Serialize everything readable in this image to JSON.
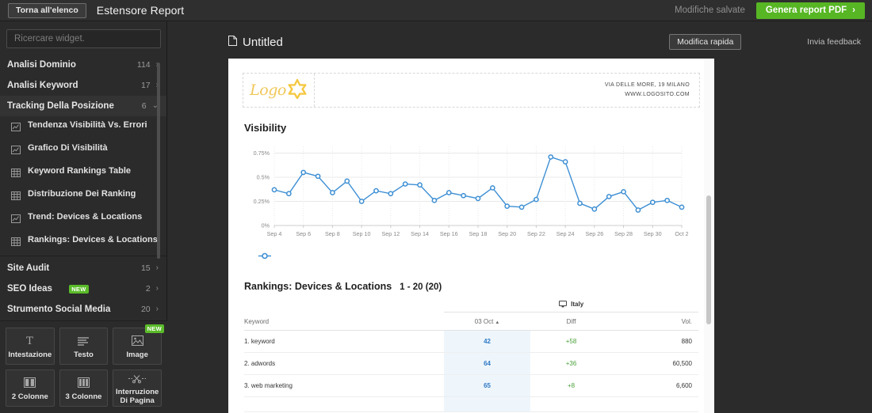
{
  "topbar": {
    "back_label": "Torna all'elenco",
    "app_title": "Estensore Report",
    "saved_status": "Modifiche salvate",
    "pdf_button": "Genera report PDF",
    "pdf_button_arrow": "›"
  },
  "sidebar": {
    "search_placeholder": "Ricercare widget.",
    "groups": [
      {
        "label": "Analisi Dominio",
        "count": "114",
        "chevron": "›",
        "open": false
      },
      {
        "label": "Analisi Keyword",
        "count": "17",
        "chevron": "›",
        "open": false
      },
      {
        "label": "Tracking Della Posizione",
        "count": "6",
        "chevron": "⌄",
        "open": true
      }
    ],
    "tracking_items": [
      {
        "label": "Tendenza Visibilità Vs. Errori",
        "icon": "line-chart-icon"
      },
      {
        "label": "Grafico Di Visibilità",
        "icon": "line-chart-icon"
      },
      {
        "label": "Keyword Rankings Table",
        "icon": "table-icon"
      },
      {
        "label": "Distribuzione Dei Ranking",
        "icon": "table-icon"
      },
      {
        "label": "Trend: Devices & Locations",
        "icon": "line-chart-icon"
      },
      {
        "label": "Rankings: Devices & Locations",
        "icon": "table-icon"
      }
    ],
    "groups_bottom": [
      {
        "label": "Site Audit",
        "count": "15",
        "chevron": "›",
        "badge": ""
      },
      {
        "label": "SEO Ideas",
        "count": "2",
        "chevron": "›",
        "badge": "new"
      },
      {
        "label": "Strumento Social Media",
        "count": "20",
        "chevron": "›",
        "badge": ""
      }
    ],
    "tiles": [
      {
        "label": "Intestazione",
        "icon": "heading-icon",
        "badge": ""
      },
      {
        "label": "Testo",
        "icon": "text-lines-icon",
        "badge": ""
      },
      {
        "label": "Image",
        "icon": "image-icon",
        "badge": "new"
      },
      {
        "label": "2 Colonne",
        "icon": "two-columns-icon",
        "badge": ""
      },
      {
        "label": "3 Colonne",
        "icon": "three-columns-icon",
        "badge": ""
      },
      {
        "label": "Interruzione Di Pagina",
        "icon": "scissors-page-break-icon",
        "badge": ""
      }
    ]
  },
  "document": {
    "title": "Untitled",
    "quick_edit": "Modifica rapida",
    "feedback": "Invia feedback",
    "letterhead": {
      "logo_text": "Logo",
      "address_line1": "VIA DELLE MORE, 19  MILANO",
      "address_line2": "WWW.LOGOSITO.COM"
    },
    "table": {
      "title": "Rankings: Devices & Locations",
      "range": "1 - 20 (20)",
      "group_header": "Italy",
      "group_icon": "desktop-monitor-icon",
      "columns": [
        "Keyword",
        "03 Oct",
        "Diff",
        "Vol."
      ],
      "sort_indicator": "▲",
      "rows": [
        {
          "keyword": "1. keyword",
          "position": "42",
          "diff": "+58",
          "vol": "880"
        },
        {
          "keyword": "2. adwords",
          "position": "64",
          "diff": "+36",
          "vol": "60,500"
        },
        {
          "keyword": "3. web marketing",
          "position": "65",
          "diff": "+8",
          "vol": "6,600"
        }
      ]
    }
  },
  "chart_data": {
    "type": "line",
    "title": "Visibility",
    "xlabel": "",
    "ylabel": "",
    "ylim": [
      0,
      0.82
    ],
    "y_ticks": [
      "0%",
      "0.25%",
      "0.5%",
      "0.75%"
    ],
    "y_tick_values": [
      0,
      0.25,
      0.5,
      0.75
    ],
    "grid": true,
    "legend_position": "bottom-left",
    "series_color": "#3d8fd4",
    "x_tick_labels": [
      "Sep 4",
      "Sep 6",
      "Sep 8",
      "Sep 10",
      "Sep 12",
      "Sep 14",
      "Sep 16",
      "Sep 18",
      "Sep 20",
      "Sep 22",
      "Sep 24",
      "Sep 26",
      "Sep 28",
      "Sep 30",
      "Oct 2"
    ],
    "x": [
      "Sep 4",
      "Sep 5",
      "Sep 6",
      "Sep 7",
      "Sep 8",
      "Sep 9",
      "Sep 10",
      "Sep 11",
      "Sep 12",
      "Sep 13",
      "Sep 14",
      "Sep 15",
      "Sep 16",
      "Sep 17",
      "Sep 18",
      "Sep 19",
      "Sep 20",
      "Sep 21",
      "Sep 22",
      "Sep 23",
      "Sep 24",
      "Sep 25",
      "Sep 26",
      "Sep 27",
      "Sep 28",
      "Sep 29",
      "Sep 30",
      "Oct 1",
      "Oct 2"
    ],
    "series": [
      {
        "name": "Visibility",
        "values": [
          0.37,
          0.33,
          0.55,
          0.51,
          0.34,
          0.46,
          0.25,
          0.36,
          0.33,
          0.43,
          0.42,
          0.26,
          0.34,
          0.31,
          0.28,
          0.39,
          0.2,
          0.19,
          0.27,
          0.71,
          0.66,
          0.23,
          0.17,
          0.3,
          0.35,
          0.16,
          0.24,
          0.26,
          0.19
        ]
      }
    ]
  }
}
